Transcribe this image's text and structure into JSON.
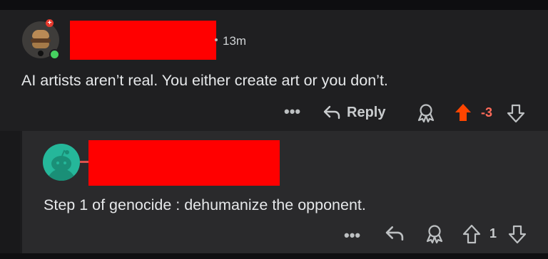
{
  "comment": {
    "age": "13m",
    "text": "AI artists aren’t real. You either create art or you don’t.",
    "more_label": "•••",
    "reply_label": "Reply",
    "score": "-3",
    "colors": {
      "upvote": "#ff4500",
      "score": "#ff6b5a"
    }
  },
  "reply": {
    "text": "Step 1 of genocide : dehumanize the opponent.",
    "more_label": "•••",
    "score": "1"
  },
  "icons": [
    "user-avatar",
    "premium-badge",
    "online-status",
    "more-options-icon",
    "reply-arrow-icon",
    "award-icon",
    "upvote-arrow-icon",
    "downvote-arrow-icon",
    "snoo-avatar"
  ]
}
